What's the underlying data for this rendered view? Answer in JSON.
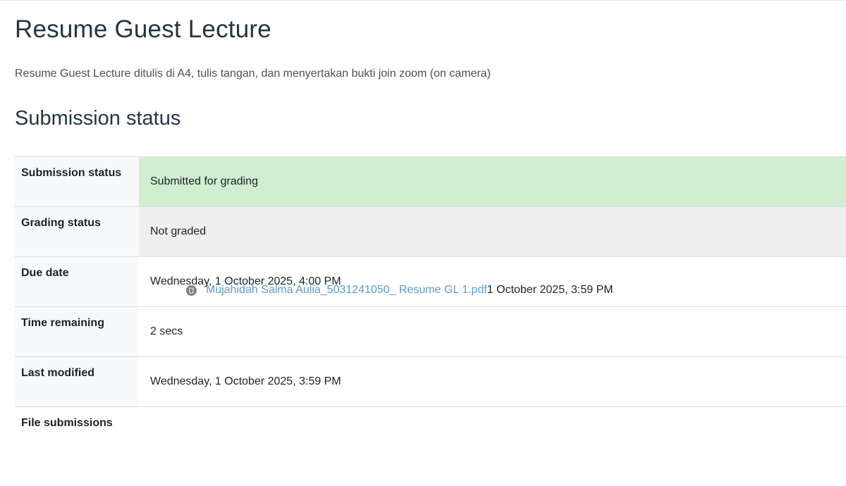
{
  "page": {
    "title": "Resume Guest Lecture",
    "intro": "Resume Guest Lecture ditulis di A4, tulis tangan, dan menyertakan bukti join zoom (on camera)",
    "section_title": "Submission status"
  },
  "status_table": {
    "rows": [
      {
        "label": "Submission status",
        "value": "Submitted for grading",
        "tone": "#d1eed1"
      },
      {
        "label": "Grading status",
        "value": "Not graded",
        "tone": "#efefef"
      },
      {
        "label": "Due date",
        "value": "Wednesday, 1 October 2025, 4:00 PM"
      },
      {
        "label": "Time remaining",
        "value": "2 secs"
      },
      {
        "label": "Last modified",
        "value": "Wednesday, 1 October 2025, 3:59 PM"
      }
    ],
    "files": {
      "label": "File submissions",
      "file_name": "Mujahidah Salma Aulia_5031241050_ Resume GL 1.pdf",
      "file_date": "1 October 2025, 3:59 PM",
      "icon": "pdf-file-icon"
    }
  },
  "colors": {
    "link": "#5b9bd0",
    "submitted_bg": "#d1eed1",
    "not_graded_bg": "#efefef"
  }
}
